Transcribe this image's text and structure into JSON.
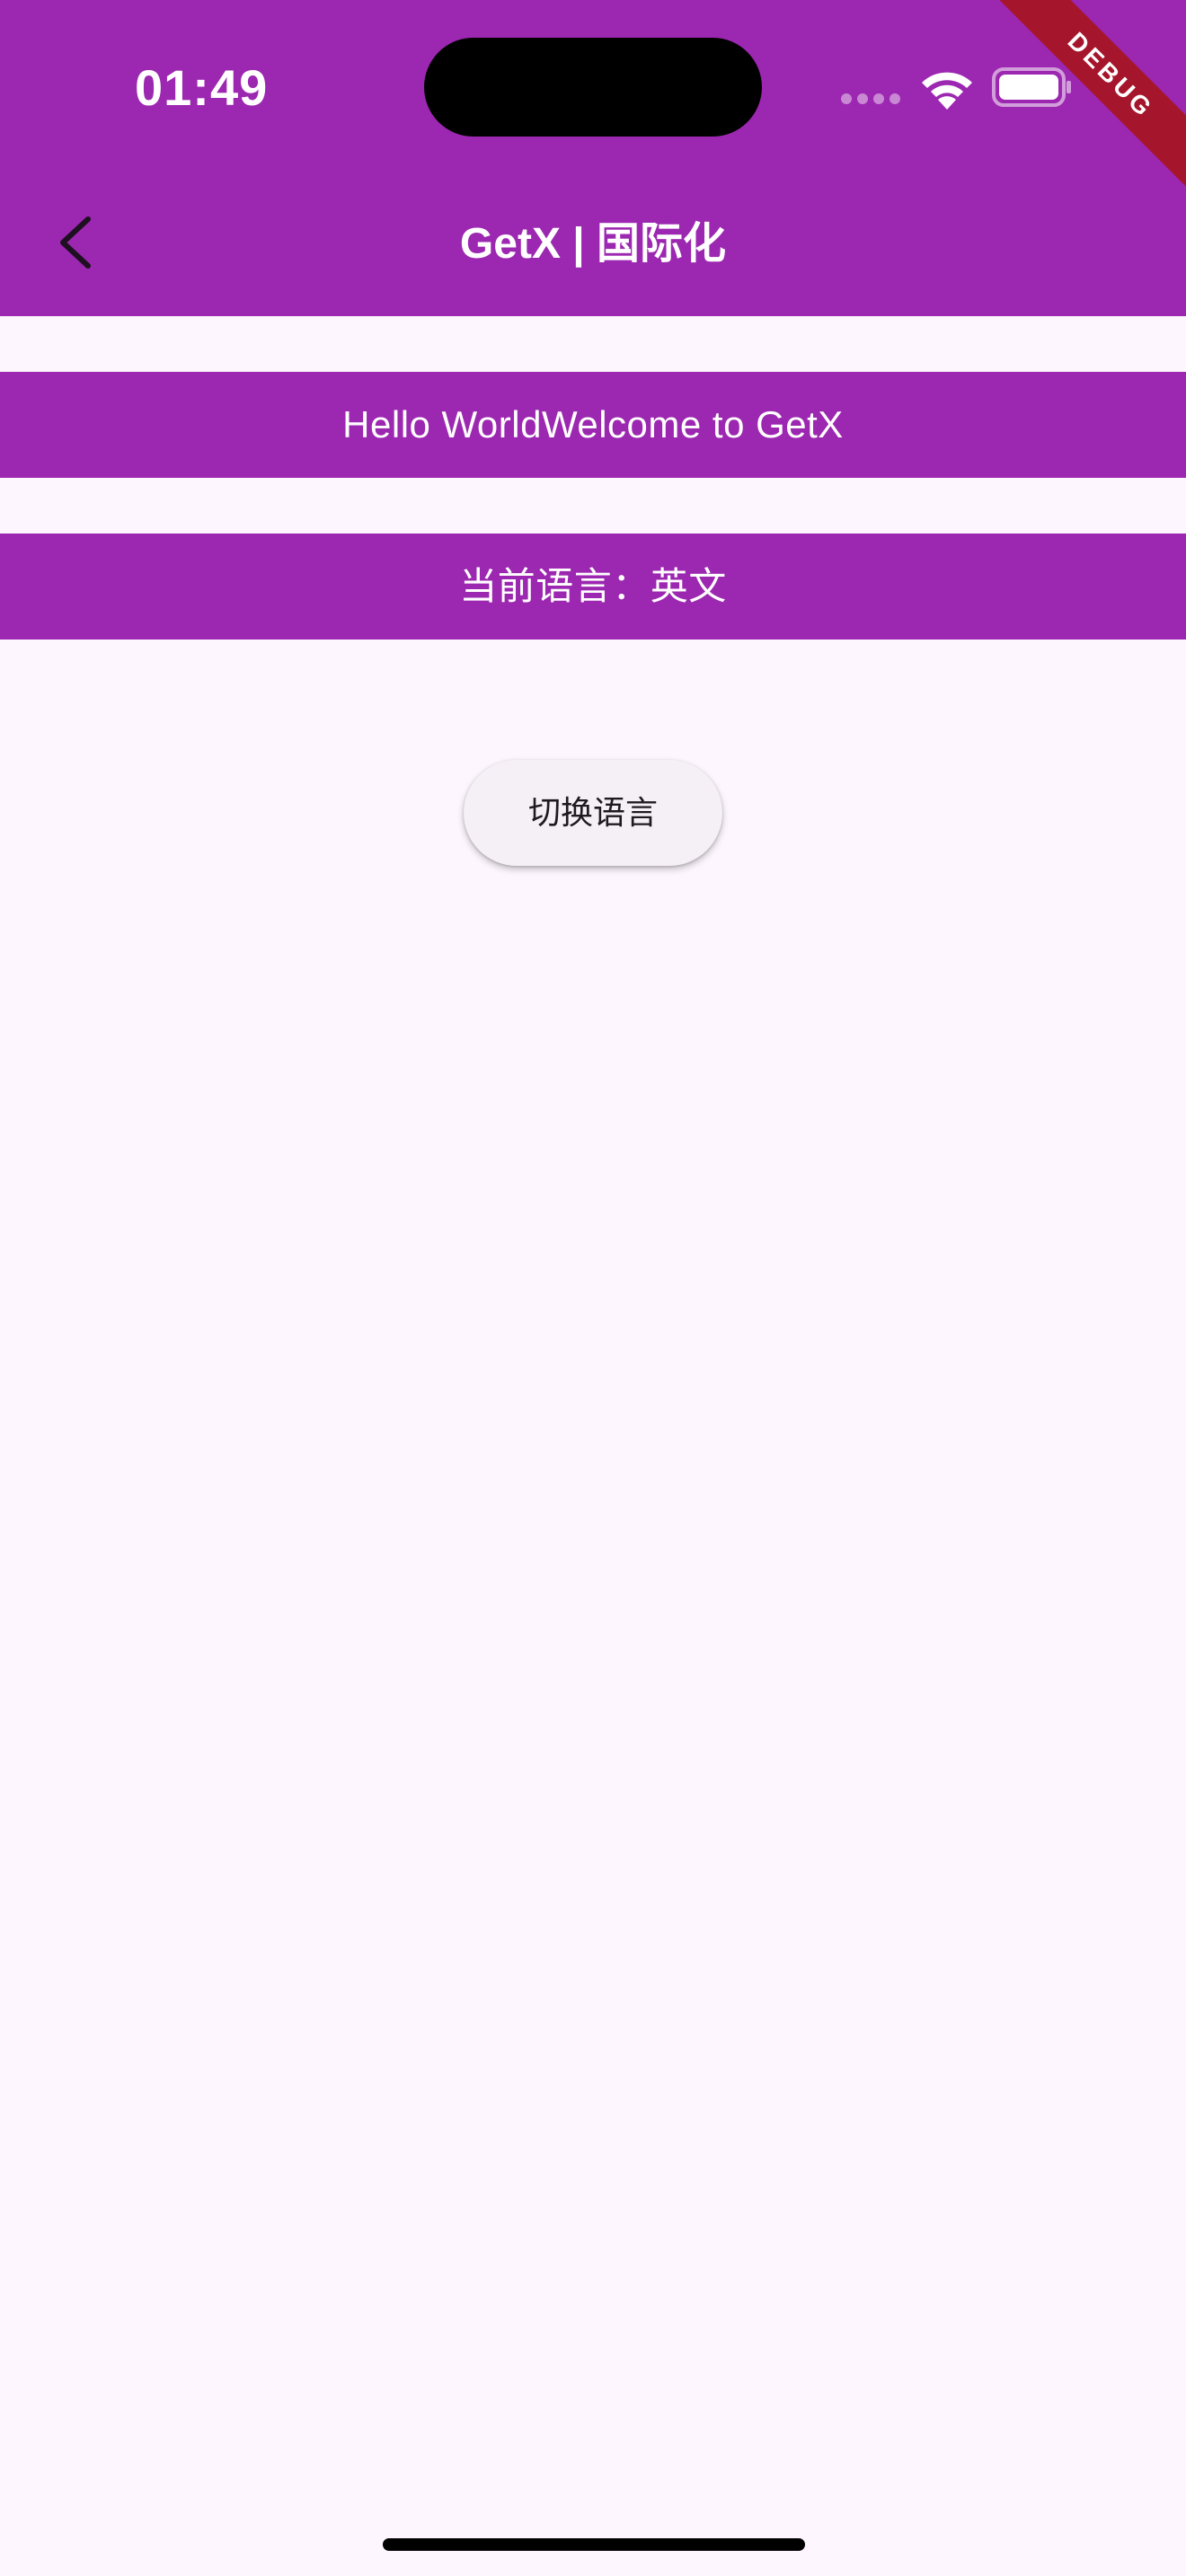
{
  "status_bar": {
    "time": "01:49",
    "signal_icon": "cellular-signal-icon",
    "wifi_icon": "wifi-icon",
    "battery_icon": "battery-icon"
  },
  "debug_banner": {
    "label": "DEBUG",
    "color": "#A5152B"
  },
  "app_bar": {
    "title": "GetX | 国际化",
    "back_icon": "chevron-left-icon",
    "color": "#9C27B0"
  },
  "content": {
    "greeting": "Hello WorldWelcome to GetX",
    "current_language": "当前语言：英文",
    "switch_button_label": "切换语言"
  },
  "colors": {
    "primary": "#9C27B0",
    "background": "#FDF6FE",
    "button_background": "#F5F0F6"
  }
}
